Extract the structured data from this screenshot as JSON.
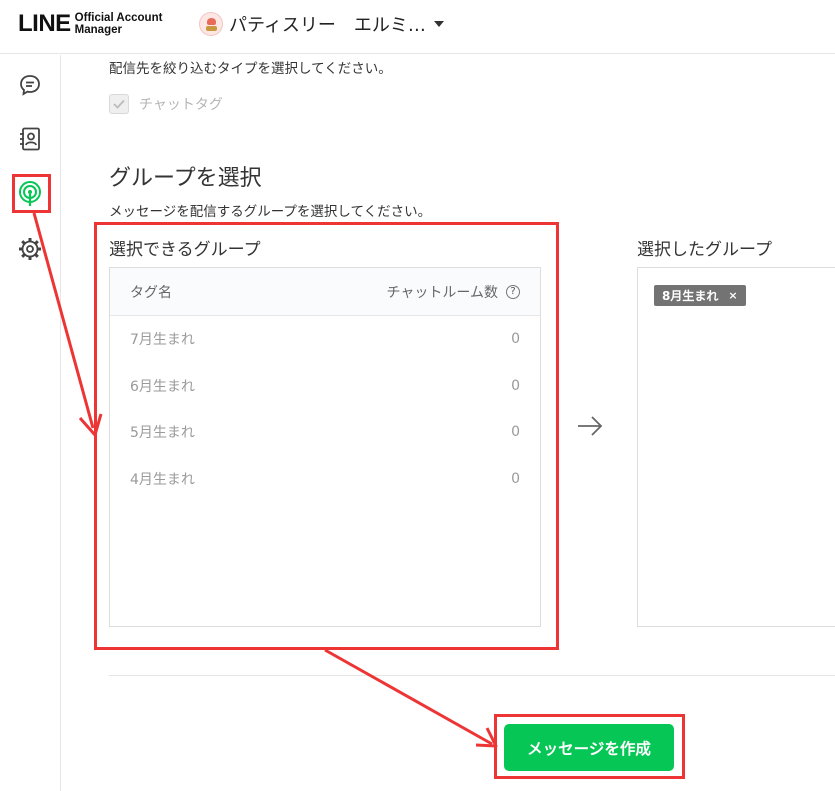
{
  "header": {
    "logo_main": "LINE",
    "logo_sub_line1": "Official Account",
    "logo_sub_line2": "Manager",
    "account_name": "パティスリー　エルミ…"
  },
  "sidebar": {
    "items": [
      {
        "name": "chat-icon"
      },
      {
        "name": "contacts-icon"
      },
      {
        "name": "broadcast-icon",
        "active": true
      },
      {
        "name": "gear-icon"
      }
    ]
  },
  "filter": {
    "intro": "配信先を絞り込むタイプを選択してください。",
    "checkbox_label": "チャットタグ"
  },
  "group_select": {
    "title": "グループを選択",
    "description": "メッセージを配信するグループを選択してください。",
    "available_title": "選択できるグループ",
    "col_tag": "タグ名",
    "col_count": "チャットルーム数",
    "help_glyph": "?",
    "rows": [
      {
        "name": "7月生まれ",
        "count": "0"
      },
      {
        "name": "6月生まれ",
        "count": "0"
      },
      {
        "name": "5月生まれ",
        "count": "0"
      },
      {
        "name": "4月生まれ",
        "count": "0"
      }
    ],
    "selected_title": "選択したグループ",
    "selected_tags": [
      {
        "label": "8月生まれ",
        "remove": "×"
      }
    ]
  },
  "actions": {
    "create_message": "メッセージを作成"
  },
  "colors": {
    "brand_green": "#06c755",
    "annotation_red": "#ee3535",
    "tag_gray": "#737373"
  }
}
